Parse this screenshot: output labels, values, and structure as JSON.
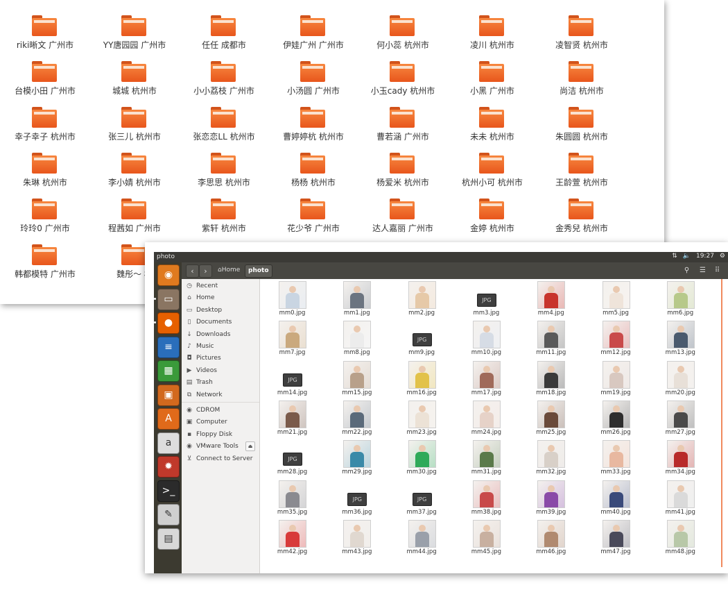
{
  "folders": [
    "riki晰文 广州市",
    "YY唐园园 广州市",
    "任任 成都市",
    "伊娃广州 广州市",
    "何小蕊 杭州市",
    "凌川 杭州市",
    "凌智贤 杭州市",
    "台模小田 广州市",
    "城城 杭州市",
    "小小荔枝 广州市",
    "小汤圆 广州市",
    "小玉cady 杭州市",
    "小黑 广州市",
    "尚洁 杭州市",
    "幸子幸子 杭州市",
    "张三儿 杭州市",
    "张恋恋LL 杭州市",
    "曹婷婷杭 杭州市",
    "曹若涵 广州市",
    "未未 杭州市",
    "朱圆圆 杭州市",
    "朱琳 杭州市",
    "李小婧 杭州市",
    "李思思 杭州市",
    "杨杨 杭州市",
    "杨爱米 杭州市",
    "杭州小可 杭州市",
    "王龄萱 杭州市",
    "玲玲0 广州市",
    "程茜如 广州市",
    "紫轩 杭州市",
    "花少爷 广州市",
    "达人嘉丽 广州市",
    "金婷 杭州市",
    "金秀兒 杭州市",
    "韩都模特 广州市",
    "魏彤～ 杭"
  ],
  "window": {
    "title": "photo",
    "time": "19:27",
    "network_icon": "network-arrows-icon",
    "volume_icon": "volume-icon",
    "power_icon": "gear-icon"
  },
  "breadcrumb": {
    "home": "Home",
    "current": "photo"
  },
  "sidebar": {
    "places": [
      {
        "label": "Recent",
        "icon": "clock-icon"
      },
      {
        "label": "Home",
        "icon": "home-icon"
      },
      {
        "label": "Desktop",
        "icon": "desktop-icon"
      },
      {
        "label": "Documents",
        "icon": "document-icon"
      },
      {
        "label": "Downloads",
        "icon": "download-icon"
      },
      {
        "label": "Music",
        "icon": "music-icon"
      },
      {
        "label": "Pictures",
        "icon": "camera-icon"
      },
      {
        "label": "Videos",
        "icon": "video-icon"
      },
      {
        "label": "Trash",
        "icon": "trash-icon"
      },
      {
        "label": "Network",
        "icon": "network-icon"
      }
    ],
    "devices": [
      {
        "label": "CDROM",
        "icon": "disc-icon"
      },
      {
        "label": "Computer",
        "icon": "computer-icon"
      },
      {
        "label": "Floppy Disk",
        "icon": "floppy-icon"
      },
      {
        "label": "VMware Tools",
        "icon": "disc-icon"
      },
      {
        "label": "Connect to Server",
        "icon": "server-icon"
      }
    ]
  },
  "launcher": [
    {
      "name": "ubuntu-logo-icon",
      "color": "#e07a1f"
    },
    {
      "name": "files-icon",
      "color": "#8a7562"
    },
    {
      "name": "firefox-icon",
      "color": "#e66000"
    },
    {
      "name": "writer-icon",
      "color": "#2a6ebb"
    },
    {
      "name": "calc-icon",
      "color": "#3a9a3a"
    },
    {
      "name": "impress-icon",
      "color": "#d2691e"
    },
    {
      "name": "software-center-icon",
      "color": "#e06a1a"
    },
    {
      "name": "amazon-icon",
      "color": "#dddddd"
    },
    {
      "name": "settings-icon",
      "color": "#c0392b"
    },
    {
      "name": "terminal-icon",
      "color": "#2b2b2b"
    },
    {
      "name": "text-editor-icon",
      "color": "#cfcfcf"
    },
    {
      "name": "drive-icon",
      "color": "#d8d8d8"
    }
  ],
  "files": [
    {
      "name": "mm0.jpg",
      "thumb": true,
      "tone": "#c9d5e2"
    },
    {
      "name": "mm1.jpg",
      "thumb": true,
      "tone": "#6b7480"
    },
    {
      "name": "mm2.jpg",
      "thumb": true,
      "tone": "#e6c9a8"
    },
    {
      "name": "mm3.jpg",
      "thumb": false
    },
    {
      "name": "mm4.jpg",
      "thumb": true,
      "tone": "#c8342c"
    },
    {
      "name": "mm5.jpg",
      "thumb": true,
      "tone": "#efe4da"
    },
    {
      "name": "mm6.jpg",
      "thumb": true,
      "tone": "#b7c98a"
    },
    {
      "name": "mm7.jpg",
      "thumb": true,
      "tone": "#caa97e"
    },
    {
      "name": "mm8.jpg",
      "thumb": true,
      "tone": "#ececec"
    },
    {
      "name": "mm9.jpg",
      "thumb": false
    },
    {
      "name": "mm10.jpg",
      "thumb": true,
      "tone": "#d6dce5"
    },
    {
      "name": "mm11.jpg",
      "thumb": true,
      "tone": "#5a5a5a"
    },
    {
      "name": "mm12.jpg",
      "thumb": true,
      "tone": "#c94a4a"
    },
    {
      "name": "mm13.jpg",
      "thumb": true,
      "tone": "#4a5a6e"
    },
    {
      "name": "mm14.jpg",
      "thumb": false
    },
    {
      "name": "mm15.jpg",
      "thumb": true,
      "tone": "#b8a08a"
    },
    {
      "name": "mm16.jpg",
      "thumb": true,
      "tone": "#e2c24a"
    },
    {
      "name": "mm17.jpg",
      "thumb": true,
      "tone": "#a06a5a"
    },
    {
      "name": "mm18.jpg",
      "thumb": true,
      "tone": "#3a3a3a"
    },
    {
      "name": "mm19.jpg",
      "thumb": true,
      "tone": "#d8c8c0"
    },
    {
      "name": "mm20.jpg",
      "thumb": true,
      "tone": "#e8e0d8"
    },
    {
      "name": "mm21.jpg",
      "thumb": true,
      "tone": "#7a5a4a"
    },
    {
      "name": "mm22.jpg",
      "thumb": true,
      "tone": "#5a6a7a"
    },
    {
      "name": "mm23.jpg",
      "thumb": true,
      "tone": "#ece2d6"
    },
    {
      "name": "mm24.jpg",
      "thumb": true,
      "tone": "#e6d2c8"
    },
    {
      "name": "mm25.jpg",
      "thumb": true,
      "tone": "#6a4a3a"
    },
    {
      "name": "mm26.jpg",
      "thumb": true,
      "tone": "#2e2e2e"
    },
    {
      "name": "mm27.jpg",
      "thumb": true,
      "tone": "#4a4a4a"
    },
    {
      "name": "mm28.jpg",
      "thumb": false
    },
    {
      "name": "mm29.jpg",
      "thumb": true,
      "tone": "#3a8aa8"
    },
    {
      "name": "mm30.jpg",
      "thumb": true,
      "tone": "#2faa5a"
    },
    {
      "name": "mm31.jpg",
      "thumb": true,
      "tone": "#5a7a4a"
    },
    {
      "name": "mm32.jpg",
      "thumb": true,
      "tone": "#d8d0c8"
    },
    {
      "name": "mm33.jpg",
      "thumb": true,
      "tone": "#e8b8a0"
    },
    {
      "name": "mm34.jpg",
      "thumb": true,
      "tone": "#b82a2a"
    },
    {
      "name": "mm35.jpg",
      "thumb": true,
      "tone": "#8a8a90"
    },
    {
      "name": "mm36.jpg",
      "thumb": false
    },
    {
      "name": "mm37.jpg",
      "thumb": false
    },
    {
      "name": "mm38.jpg",
      "thumb": true,
      "tone": "#c84a4a"
    },
    {
      "name": "mm39.jpg",
      "thumb": true,
      "tone": "#8a4aa8"
    },
    {
      "name": "mm40.jpg",
      "thumb": true,
      "tone": "#3a4a7a"
    },
    {
      "name": "mm41.jpg",
      "thumb": true,
      "tone": "#dadada"
    },
    {
      "name": "mm42.jpg",
      "thumb": true,
      "tone": "#d83a3a"
    },
    {
      "name": "mm43.jpg",
      "thumb": true,
      "tone": "#e0d8d0"
    },
    {
      "name": "mm44.jpg",
      "thumb": true,
      "tone": "#9aa0aa"
    },
    {
      "name": "mm45.jpg",
      "thumb": true,
      "tone": "#c8b0a0"
    },
    {
      "name": "mm46.jpg",
      "thumb": true,
      "tone": "#b08a70"
    },
    {
      "name": "mm47.jpg",
      "thumb": true,
      "tone": "#4a4a5a"
    },
    {
      "name": "mm48.jpg",
      "thumb": true,
      "tone": "#b8c8a8"
    }
  ],
  "jpg_badge_label": "JPG",
  "colors": {
    "folder_orange": "#ee6a2a",
    "topbar": "#3b3a36",
    "launcher": "#3c3a30",
    "scroll_accent": "#f08a5d"
  }
}
